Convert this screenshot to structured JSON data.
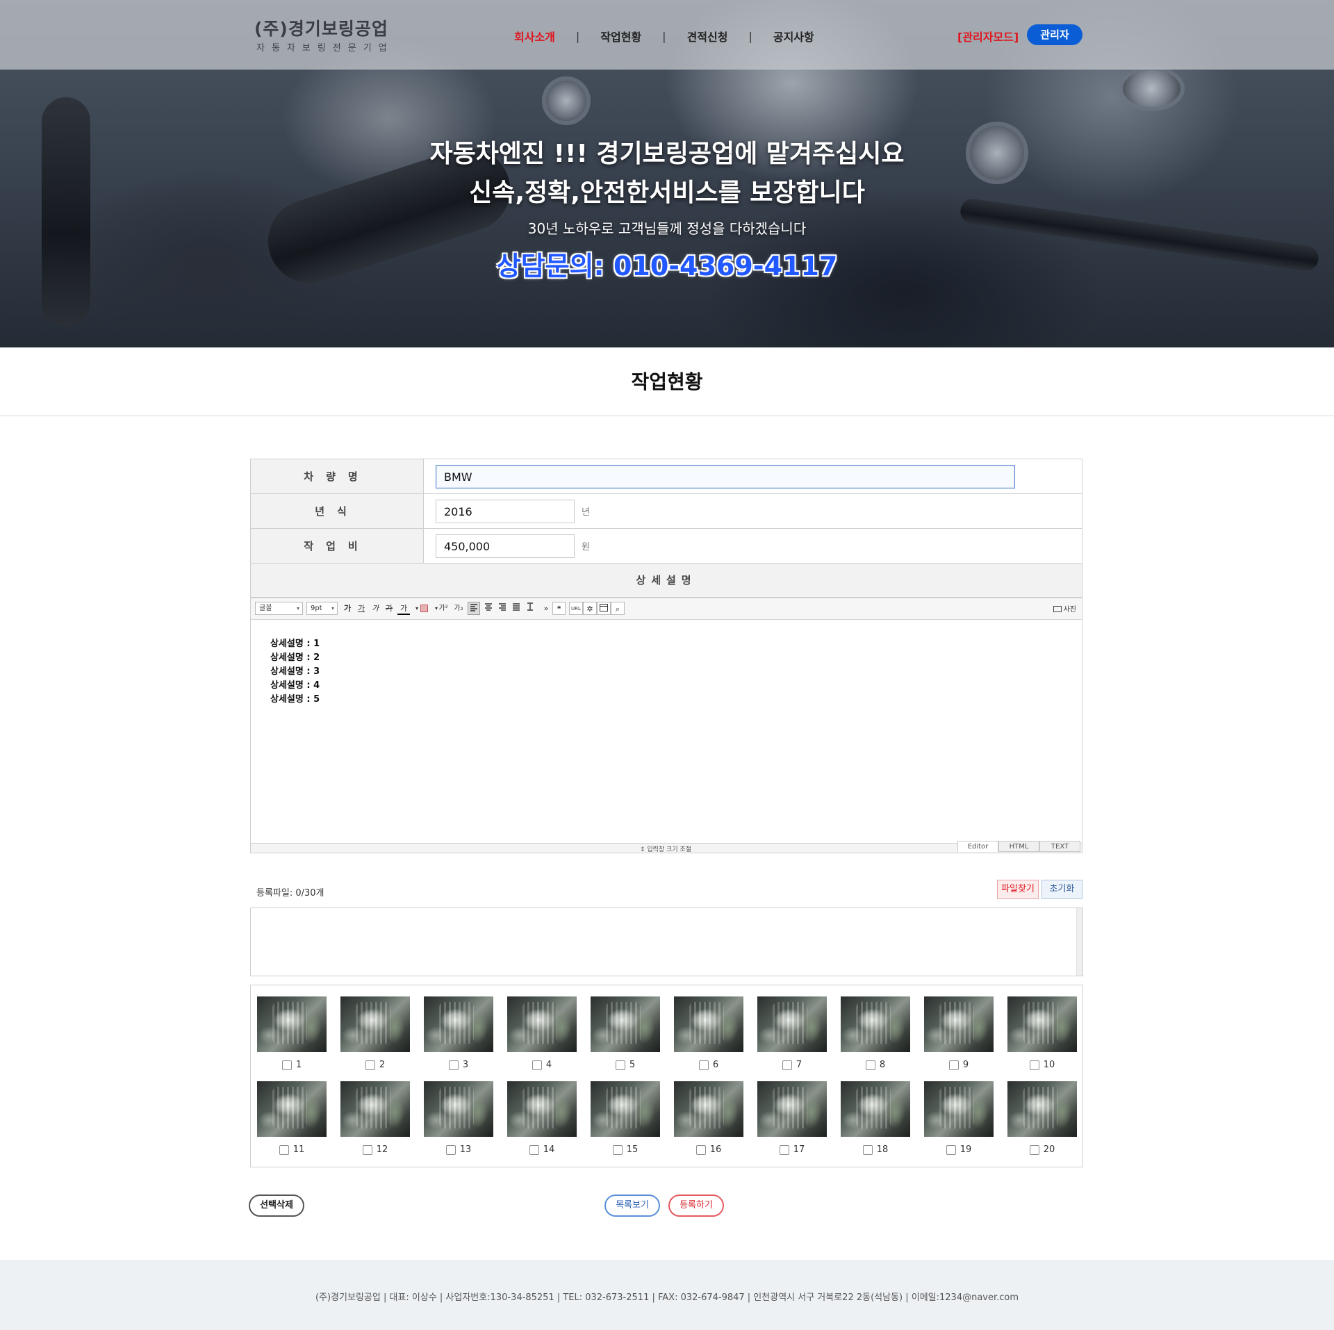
{
  "header": {
    "logo_title": "(주)경기보링공업",
    "logo_subtitle": "자동차보링전문기업",
    "nav": [
      "회사소개",
      "작업현황",
      "견적신청",
      "공지사항"
    ],
    "nav_separator": "|",
    "admin_mode": "[관리자모드]",
    "admin_button": "관리자",
    "accent_red": "#e0141e",
    "accent_blue": "#0b5dd6"
  },
  "hero": {
    "line1": "자동차엔진 !!! 경기보링공업에 맡겨주십시요",
    "line2": "신속,정확,안전한서비스를 보장합니다",
    "sub": "30년 노하우로 고객님들께 정성을 다하겠습니다",
    "phone": "상담문의: 010-4369-4117"
  },
  "page_title": "작업현황",
  "form": {
    "vehicle_label": "차량명",
    "vehicle_value": "BMW",
    "year_label": "년식",
    "year_value": "2016",
    "year_unit": "년",
    "cost_label": "작업비",
    "cost_value": "450,000",
    "cost_unit": "원",
    "description_label": "상세설명"
  },
  "editor": {
    "font_select": "글꼴",
    "size_select": "9pt",
    "toolbar_icons": [
      "bold-icon",
      "underline-icon",
      "italic-icon",
      "strikethrough-icon",
      "font-color-icon",
      "highlight-icon",
      "superscript-icon",
      "subscript-icon",
      "align-left-icon",
      "align-center-icon",
      "align-right-icon",
      "justify-icon",
      "line-height-icon",
      "more-icon",
      "quote-icon",
      "url-icon",
      "special-char-icon",
      "table-icon",
      "find-icon"
    ],
    "tb_bold": "가",
    "tb_underline": "가",
    "tb_italic": "가",
    "tb_strike": "가",
    "tb_fontcolor": "가",
    "tb_super": "가²",
    "tb_sub": "가₂",
    "tb_more": "»",
    "tb_quote": "❝",
    "tb_url": "URL",
    "tb_special": "✲",
    "tb_find": "⌕",
    "photo_button": "사진",
    "content": [
      "상세설명 : 1",
      "상세설명 : 2",
      "상세설명 : 3",
      "상세설명 : 4",
      "상세설명 : 5"
    ],
    "resize_label": "⇕ 입력창 크기 조절",
    "modes": [
      "Editor",
      "HTML",
      "TEXT"
    ]
  },
  "files": {
    "count_label": "등록파일: 0/30개",
    "find_button": "파일찾기",
    "reset_button": "초기화"
  },
  "gallery": {
    "items": [
      "1",
      "2",
      "3",
      "4",
      "5",
      "6",
      "7",
      "8",
      "9",
      "10",
      "11",
      "12",
      "13",
      "14",
      "15",
      "16",
      "17",
      "18",
      "19",
      "20"
    ]
  },
  "actions": {
    "delete_selected": "선택삭제",
    "list": "목록보기",
    "submit": "등록하기"
  },
  "footer": {
    "text": "(주)경기보링공업   |  대표: 이상수  |  사업자번호:130-34-85251  |  TEL: 032-673-2511  |  FAX: 032-674-9847  |  인천광역시 서구 거북로22 2동(석남동)   |  이메일:1234@naver.com"
  }
}
